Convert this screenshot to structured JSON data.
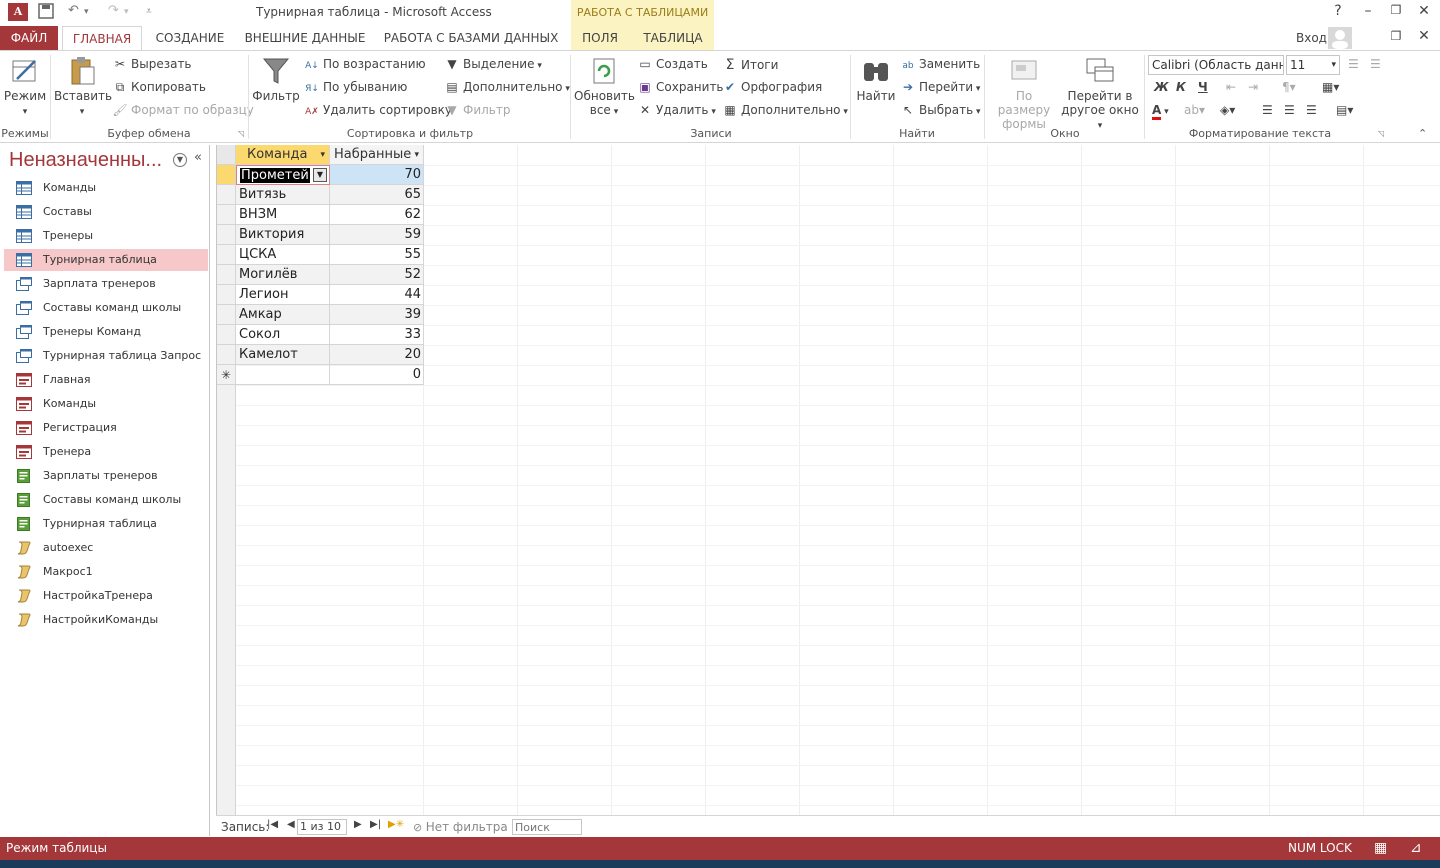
{
  "app": {
    "logo": "A",
    "window_title": "Турнирная таблица - Microsoft Access",
    "context_group": "РАБОТА С ТАБЛИЦАМИ",
    "user_label": "Вход"
  },
  "tabs": {
    "file": "ФАЙЛ",
    "home": "ГЛАВНАЯ",
    "create": "СОЗДАНИЕ",
    "external": "ВНЕШНИЕ ДАННЫЕ",
    "database": "РАБОТА С БАЗАМИ ДАННЫХ",
    "fields": "ПОЛЯ",
    "table": "ТАБЛИЦА"
  },
  "ribbon": {
    "views": {
      "mode": "Режим",
      "label": "Режимы"
    },
    "clipboard": {
      "paste": "Вставить",
      "cut": "Вырезать",
      "copy": "Копировать",
      "format_painter": "Формат по образцу",
      "label": "Буфер обмена"
    },
    "sort_filter": {
      "filter": "Фильтр",
      "ascending": "По возрастанию",
      "descending": "По убыванию",
      "remove_sort": "Удалить сортировку",
      "selection": "Выделение",
      "advanced": "Дополнительно",
      "toggle_filter": "Фильтр",
      "label": "Сортировка и фильтр"
    },
    "records": {
      "refresh_line1": "Обновить",
      "refresh_line2": "все",
      "new": "Создать",
      "save": "Сохранить",
      "delete": "Удалить",
      "totals": "Итоги",
      "spelling": "Орфография",
      "more": "Дополнительно",
      "label": "Записи"
    },
    "find": {
      "find": "Найти",
      "replace": "Заменить",
      "goto": "Перейти",
      "select": "Выбрать",
      "label": "Найти"
    },
    "window": {
      "fit_line1": "По размеру",
      "fit_line2": "формы",
      "switch_line1": "Перейти в",
      "switch_line2": "другое окно",
      "label": "Окно"
    },
    "text_format": {
      "font": "Calibri (Область данны",
      "size": "11",
      "bold": "Ж",
      "italic": "К",
      "underline": "Ч",
      "label": "Форматирование текста"
    }
  },
  "nav": {
    "title": "Неназначенны...",
    "items": [
      {
        "label": "Команды",
        "type": "table"
      },
      {
        "label": "Составы",
        "type": "table"
      },
      {
        "label": "Тренеры",
        "type": "table"
      },
      {
        "label": "Турнирная таблица",
        "type": "table",
        "selected": true
      },
      {
        "label": "Зарплата тренеров",
        "type": "query"
      },
      {
        "label": "Составы команд школы",
        "type": "query"
      },
      {
        "label": "Тренеры Команд",
        "type": "query"
      },
      {
        "label": "Турнирная таблица Запрос",
        "type": "query"
      },
      {
        "label": "Главная",
        "type": "form"
      },
      {
        "label": "Команды",
        "type": "form"
      },
      {
        "label": "Регистрация",
        "type": "form"
      },
      {
        "label": "Тренера",
        "type": "form"
      },
      {
        "label": "Зарплаты тренеров",
        "type": "report"
      },
      {
        "label": "Составы команд школы",
        "type": "report"
      },
      {
        "label": "Турнирная таблица",
        "type": "report"
      },
      {
        "label": "autoexec",
        "type": "macro"
      },
      {
        "label": "Макрос1",
        "type": "macro"
      },
      {
        "label": "НастройкаТренера",
        "type": "macro"
      },
      {
        "label": "НастройкиКоманды",
        "type": "macro"
      }
    ]
  },
  "table": {
    "columns": [
      "Команда",
      "Набранные"
    ],
    "rows": [
      {
        "team": "Прометей",
        "points": "70"
      },
      {
        "team": "Витязь",
        "points": "65"
      },
      {
        "team": "ВНЗМ",
        "points": "62"
      },
      {
        "team": "Виктория",
        "points": "59"
      },
      {
        "team": "ЦСКА",
        "points": "55"
      },
      {
        "team": "Могилёв",
        "points": "52"
      },
      {
        "team": "Легион",
        "points": "44"
      },
      {
        "team": "Амкар",
        "points": "39"
      },
      {
        "team": "Сокол",
        "points": "33"
      },
      {
        "team": "Камелот",
        "points": "20"
      }
    ],
    "new_row_marker": "✳",
    "new_row_default": "0"
  },
  "record_nav": {
    "label": "Запись:",
    "position": "1 из 10",
    "filter": "Нет фильтра",
    "search_placeholder": "Поиск"
  },
  "status": {
    "mode": "Режим таблицы",
    "num_lock": "NUM LOCK"
  },
  "colors": {
    "accent": "#a4373a",
    "selected_nav": "#f6c8c9",
    "header_highlight": "#fbd96e",
    "selected_cell": "#cde4f7",
    "context_tab": "#fcf3c2"
  }
}
